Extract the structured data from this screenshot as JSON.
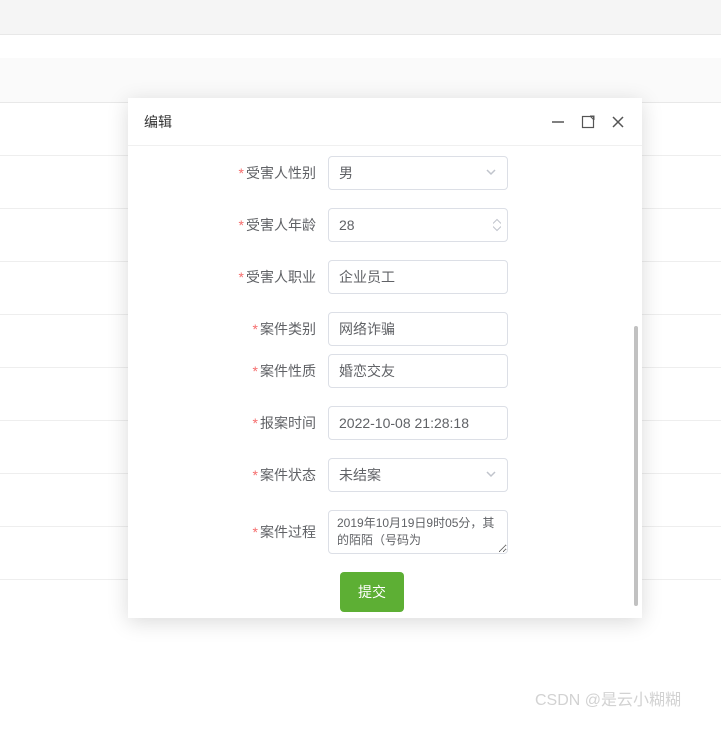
{
  "modal": {
    "title": "编辑",
    "submit_label": "提交"
  },
  "form": {
    "gender": {
      "label": "受害人性别",
      "value": "男"
    },
    "age": {
      "label": "受害人年龄",
      "value": "28"
    },
    "occupation": {
      "label": "受害人职业",
      "value": "企业员工"
    },
    "case_category": {
      "label": "案件类别",
      "value": "网络诈骗"
    },
    "case_nature": {
      "label": "案件性质",
      "value": "婚恋交友"
    },
    "report_time": {
      "label": "报案时间",
      "value": "2022-10-08 21:28:18"
    },
    "case_status": {
      "label": "案件状态",
      "value": "未结案"
    },
    "case_process": {
      "label": "案件过程",
      "value": "2019年10月19日9时05分，其的陌陌（号码为"
    }
  },
  "watermark": "CSDN @是云小糊糊"
}
